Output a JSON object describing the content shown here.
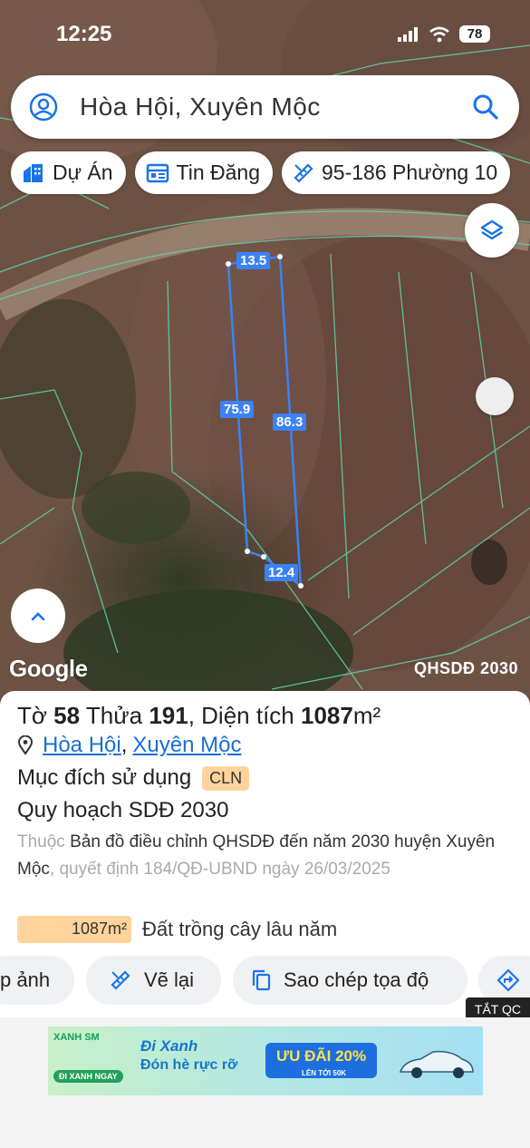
{
  "status_bar": {
    "time": "12:25",
    "battery": "78"
  },
  "search": {
    "query": "Hòa Hội, Xuyên Mộc"
  },
  "chips": [
    {
      "label": "Dự Án",
      "icon": "building-icon"
    },
    {
      "label": "Tin Đăng",
      "icon": "listing-icon"
    },
    {
      "label": "95-186 Phường 10",
      "icon": "ruler-icon"
    }
  ],
  "map": {
    "logo": "Google",
    "mode_label": "QHSDĐ 2030",
    "dimensions": {
      "top": "13.5",
      "left": "75.9",
      "right": "86.3",
      "bottom": "12.4"
    }
  },
  "panel": {
    "title_prefix": "Tờ",
    "sheet_no": "58",
    "title_mid": "Thửa",
    "parcel_no": "191",
    "title_area_prefix": ", Diện tích",
    "area_value": "1087",
    "area_unit": "m²",
    "location_commune": "Hòa Hội",
    "location_district": "Xuyên Mộc",
    "location_sep": ",",
    "purpose_label": "Mục đích sử dụng",
    "purpose_code": "CLN",
    "plan_title": "Quy hoạch SDĐ 2030",
    "desc_prefix": "Thuộc",
    "desc_main": "Bản đồ điều chỉnh QHSDĐ đến năm 2030 huyện Xuyên Mộc",
    "desc_suffix": ", quyết định 184/QĐ-UBND ngày 26/03/2025",
    "area_bar_value": "1087m²",
    "area_bar_fill_fraction": 1.0,
    "land_type": "Đất trồng cây lâu năm"
  },
  "actions": [
    {
      "label": "p ảnh",
      "icon": ""
    },
    {
      "label": "Vẽ lại",
      "icon": "ruler-icon"
    },
    {
      "label": "Sao chép tọa độ",
      "icon": "copy-icon"
    },
    {
      "label": "",
      "icon": "directions-icon"
    }
  ],
  "ad": {
    "close_label": "TẮT QC",
    "brand": "XANH SM",
    "cta": "ĐI XANH NGAY",
    "headline1": "Đi Xanh",
    "headline2": "Đón hè rực rỡ",
    "offer": "ƯU ĐÃI 20%",
    "offer_sub": "LÊN TỚI 50K"
  },
  "colors": {
    "accent": "#3b82f6",
    "badge": "#ffd39b",
    "link": "#1a6fd1",
    "boundary": "#5fd3b0"
  }
}
